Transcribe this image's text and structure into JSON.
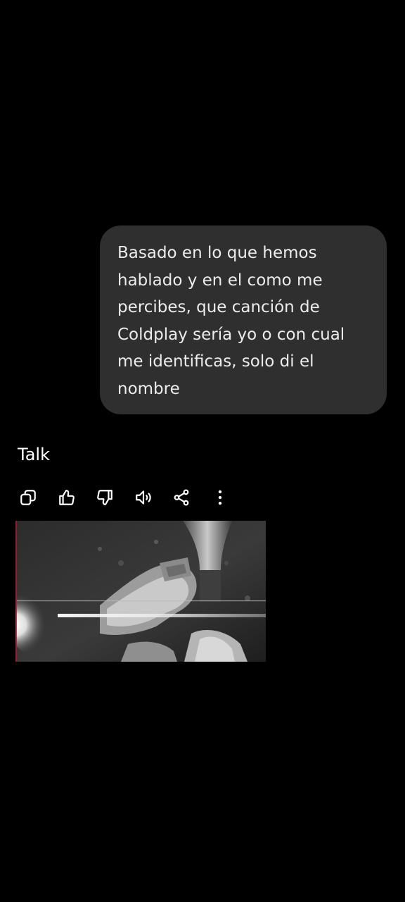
{
  "conversation": {
    "user_message": "Basado en lo que hemos\nhablado y en el como me\npercibes, que canción de\nColdplay sería yo o con cual\nme identificas, solo di el\nnombre",
    "assistant_reply": "Talk"
  },
  "action_bar": {
    "buttons": [
      {
        "name": "copy",
        "icon": "copy-icon"
      },
      {
        "name": "thumbs-up",
        "icon": "thumbs-up-icon"
      },
      {
        "name": "thumbs-down",
        "icon": "thumbs-down-icon"
      },
      {
        "name": "read-aloud",
        "icon": "speaker-icon"
      },
      {
        "name": "share",
        "icon": "share-icon"
      },
      {
        "name": "more",
        "icon": "more-vertical-icon"
      }
    ]
  },
  "media": {
    "type": "video-still",
    "tone": "grayscale"
  },
  "colors": {
    "background": "#000000",
    "user_bubble": "#2f2f2f",
    "text": "#ffffff"
  }
}
